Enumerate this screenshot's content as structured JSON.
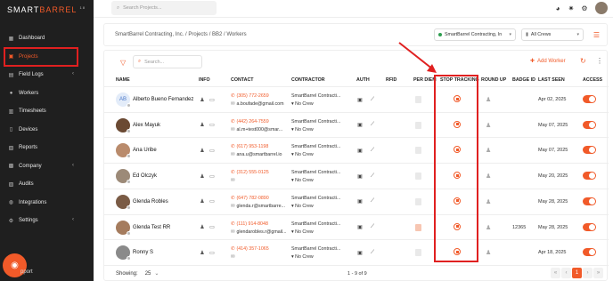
{
  "app": {
    "logo_left": "SMART",
    "logo_right": "BARREL",
    "logo_sup": "18"
  },
  "sidebar": {
    "items": [
      {
        "label": "Dashboard",
        "icon": "dashboard-icon",
        "glyph": "▦"
      },
      {
        "label": "Projects",
        "icon": "folder-icon",
        "glyph": "▣"
      },
      {
        "label": "Field Logs",
        "icon": "field-logs-icon",
        "glyph": "▤",
        "chevron": "‹"
      },
      {
        "label": "Workers",
        "icon": "workers-icon",
        "glyph": "●"
      },
      {
        "label": "Timesheets",
        "icon": "timesheets-icon",
        "glyph": "▥"
      },
      {
        "label": "Devices",
        "icon": "devices-icon",
        "glyph": "▯"
      },
      {
        "label": "Reports",
        "icon": "reports-icon",
        "glyph": "▧"
      },
      {
        "label": "Company",
        "icon": "company-icon",
        "glyph": "▩",
        "chevron": "‹"
      },
      {
        "label": "Audits",
        "icon": "audits-icon",
        "glyph": "▨"
      },
      {
        "label": "Integrations",
        "icon": "integrations-icon",
        "glyph": "◍"
      },
      {
        "label": "Settings",
        "icon": "settings-icon",
        "glyph": "⚙",
        "chevron": "‹"
      }
    ],
    "support_label": "pport"
  },
  "topbar": {
    "search_placeholder": "Search Projects..."
  },
  "breadcrumb": {
    "path": "SmartBarrel Contracting, Inc.  /  Projects  /  BB2  /  Workers",
    "company_select": "SmartBarrel Contracting, In",
    "crews_select": "All Crews"
  },
  "table": {
    "search_placeholder": "Search...",
    "add_worker_label": "Add Worker",
    "columns": [
      "NAME",
      "INFO",
      "CONTACT",
      "CONTRACTOR",
      "AUTH",
      "RFID",
      "PER DIEM",
      "STOP TRACKING",
      "ROUND UP",
      "BADGE ID",
      "LAST SEEN",
      "ACCESS"
    ],
    "rows": [
      {
        "initials": "AB",
        "name": "Alberto Bueno Fernandez",
        "phone": "(305) 772-2659",
        "email": "a.boufade@gmail.com",
        "contractor": "SmartBarrel Contracti...",
        "crew": "No Crew",
        "badge": "",
        "last_seen": "Apr 02, 2025",
        "perdiem_orange": false,
        "access": true
      },
      {
        "initials": "",
        "name": "Alex Mayuk",
        "phone": "(442) 264-7559",
        "email": "al.m+test000@smar...",
        "contractor": "SmartBarrel Contracti...",
        "crew": "No Crew",
        "badge": "",
        "last_seen": "May 07, 2025",
        "perdiem_orange": false,
        "access": true
      },
      {
        "initials": "",
        "name": "Ana Uribe",
        "phone": "(617) 953-1198",
        "email": "ana.u@smartbarrel.io",
        "contractor": "SmartBarrel Contracti...",
        "crew": "No Crew",
        "badge": "",
        "last_seen": "May 07, 2025",
        "perdiem_orange": false,
        "access": true
      },
      {
        "initials": "",
        "name": "Ed Olczyk",
        "phone": "(312) 555-0125",
        "email": "",
        "contractor": "SmartBarrel Contracti...",
        "crew": "No Crew",
        "badge": "",
        "last_seen": "May 20, 2025",
        "perdiem_orange": false,
        "access": true
      },
      {
        "initials": "",
        "name": "Glenda Robles",
        "phone": "(647) 782-0890",
        "email": "glenda.r@smartbarre...",
        "contractor": "SmartBarrel Contracti...",
        "crew": "No Crew",
        "badge": "",
        "last_seen": "May 28, 2025",
        "perdiem_orange": false,
        "access": true
      },
      {
        "initials": "",
        "name": "Glenda Test RR",
        "phone": "(111) 914-8048",
        "email": "glendarobles.r@gmail...",
        "contractor": "SmartBarrel Contracti...",
        "crew": "No Crew",
        "badge": "12365",
        "last_seen": "May 28, 2025",
        "perdiem_orange": true,
        "access": true
      },
      {
        "initials": "",
        "name": "Ronny S",
        "phone": "(414) 357-1065",
        "email": "",
        "contractor": "SmartBarrel Contracti...",
        "crew": "No Crew",
        "badge": "",
        "last_seen": "Apr 18, 2025",
        "perdiem_orange": false,
        "access": true
      }
    ]
  },
  "footer": {
    "showing_label": "Showing:",
    "page_size": "25",
    "count_text": "1 - 9 of 9",
    "pager": [
      "«",
      "‹",
      "1",
      "›",
      "»"
    ]
  }
}
